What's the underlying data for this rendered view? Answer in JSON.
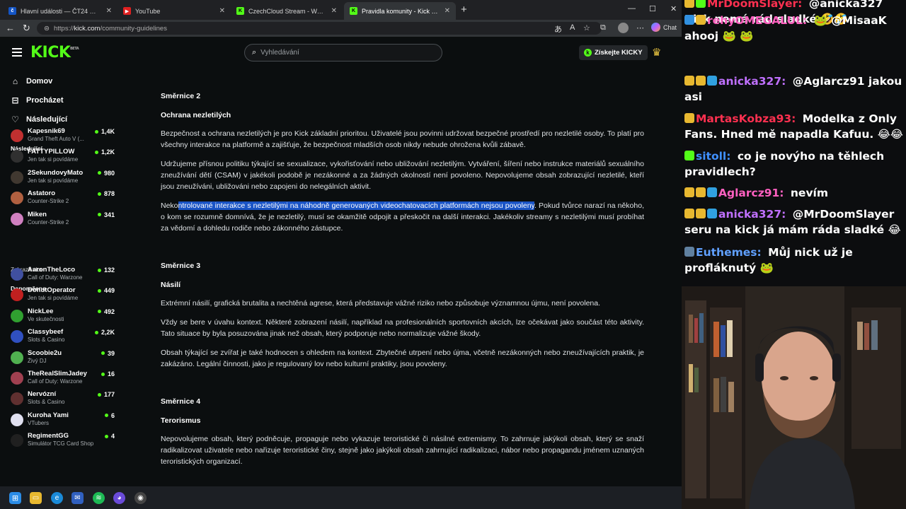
{
  "tabs": [
    {
      "label": "Hlavní události — ČT24 — Česká t",
      "favicon": "ct24",
      "color": "#1455c5"
    },
    {
      "label": "YouTube",
      "favicon": "youtube",
      "color": "#e02020"
    },
    {
      "label": "CzechCloud Stream - Watch Live o",
      "favicon": "kick",
      "color": "#53fc18"
    },
    {
      "label": "Pravidla komunity - Kick Streaming",
      "favicon": "kick",
      "color": "#53fc18"
    }
  ],
  "url": {
    "prefix": "https://",
    "host": "kick.com",
    "path": "/community-guidelines"
  },
  "chat_button": "Chat",
  "kick": {
    "logo": "KICK",
    "logo_beta": "BETA",
    "search_placeholder": "Vyhledávání",
    "kicky_button": "Získejte KICKY",
    "nav": [
      {
        "label": "Domov",
        "icon": "home-icon"
      },
      {
        "label": "Procházet",
        "icon": "browse-icon"
      },
      {
        "label": "Následující",
        "icon": "heart-icon"
      }
    ],
    "following_title": "Následující",
    "following": [
      {
        "name": "Kapesnik69",
        "category": "Grand Theft Auto V (...",
        "viewers": "1,4K",
        "color": "#c03030"
      },
      {
        "name": "FATTYPILLOW",
        "category": "Jen tak si povídáme",
        "viewers": "1,2K",
        "color": "#303030"
      },
      {
        "name": "2SekundovyMato",
        "category": "Jen tak si povídáme",
        "viewers": "980",
        "color": "#403830"
      },
      {
        "name": "Astatoro",
        "category": "Counter-Strike 2",
        "viewers": "878",
        "color": "#b06040"
      },
      {
        "name": "Miken",
        "category": "Counter-Strike 2",
        "viewers": "341",
        "color": "#d080c0"
      }
    ],
    "show_more": "Zobrazit více",
    "recommended_title": "Doporučeno",
    "recommended": [
      {
        "name": "AaronTheLoco",
        "category": "Call of Duty: Warzone",
        "viewers": "132",
        "color": "#4050a0"
      },
      {
        "name": "DonutOperator",
        "category": "Jen tak si povídáme",
        "viewers": "449",
        "color": "#c02020"
      },
      {
        "name": "NickLee",
        "category": "Ve skutečnosti",
        "viewers": "492",
        "color": "#30a030"
      },
      {
        "name": "Classybeef",
        "category": "Slots & Casino",
        "viewers": "2,2K",
        "color": "#3050c0"
      },
      {
        "name": "Scoobie2u",
        "category": "Živý DJ",
        "viewers": "39",
        "color": "#50b050"
      },
      {
        "name": "TheRealSlimJadey",
        "category": "Call of Duty: Warzone",
        "viewers": "16",
        "color": "#a04050"
      },
      {
        "name": "Nervózní",
        "category": "Slots & Casino",
        "viewers": "177",
        "color": "#603030"
      },
      {
        "name": "Kuroha Yami",
        "category": "VTubers",
        "viewers": "6",
        "color": "#e0e0f0"
      },
      {
        "name": "RegimentGG",
        "category": "Simulátor TCG Card Shop",
        "viewers": "4",
        "color": "#202020"
      }
    ],
    "guidelines": {
      "s2_title": "Směrnice 2",
      "s2_sub": "Ochrana nezletilých",
      "s2_p1": "Bezpečnost a ochrana nezletilých je pro Kick základní prioritou. Uživatelé jsou povinni udržovat bezpečné prostředí pro nezletilé osoby. To platí pro všechny interakce na platformě a zajišťuje, že bezpečnost mladších osob nikdy nebude ohrožena kvůli zábavě.",
      "s2_p2": "Udržujeme přísnou politiku týkající se sexualizace, vykořisťování nebo ubližování nezletilým. Vytváření, šíření nebo instrukce materiálů sexuálního zneužívání dětí (CSAM) v jakékoli podobě je nezákonné a za žádných okolností není povoleno. Nepovolujeme obsah zobrazující nezletilé, kteří jsou zneužíváni, ubližováni nebo zapojeni do nelegálních aktivit.",
      "s2_p3_pre": "Neko",
      "s2_p3_hl": "ntrolované interakce s nezletilými na náhodně generovaných videochatovacích platformách nejsou povoleny",
      "s2_p3_post": ". Pokud tvůrce narazí na někoho, o kom se rozumně domnívá, že je nezletilý, musí se okamžitě odpojit a přeskočit na další interakci. Jakékoliv streamy s nezletilými musí probíhat za vědomí a dohledu rodiče nebo zákonného zástupce.",
      "s3_title": "Směrnice 3",
      "s3_sub": "Násilí",
      "s3_p1": "Extrémní násilí, grafická brutalita a nechtěná agrese, která představuje vážné riziko nebo způsobuje významnou újmu, není povolena.",
      "s3_p2": "Vždy se bere v úvahu kontext. Některé zobrazení násilí, například na profesionálních sportovních akcích, lze očekávat jako součást této aktivity. Tato situace by byla posuzována jinak než obsah, který podporuje nebo normalizuje vážné škody.",
      "s3_p3": "Obsah týkající se zvířat je také hodnocen s ohledem na kontext. Zbytečné utrpení nebo újma, včetně nezákonných nebo zneužívajících praktik, je zakázáno. Legální činnosti, jako je regulovaný lov nebo kulturní praktiky, jsou povoleny.",
      "s4_title": "Směrnice 4",
      "s4_sub": "Terorismus",
      "s4_p1": "Nepovolujeme obsah, který podněcuje, propaguje nebo vykazuje teroristické či násilné extremismy. To zahrnuje jakýkoli obsah, který se snaží radikalizovat uživatele nebo nařizuje teroristické činy, stejně jako jakýkoli obsah zahrnující radikalizaci, nábor nebo propagandu jménem uznaných teroristických organizací."
    }
  },
  "chat": [
    {
      "user": "MrDoomSlayer:",
      "color": "#ff3050",
      "text": " @anicka327 Kick nemá rád sladké 🤣🤣"
    },
    {
      "user": "rehyOMEGALUL:",
      "color": "#ff60c0",
      "text": " 🐸 @MisaaK ahooj 🐸 🐸"
    },
    {
      "user": "anicka327:",
      "color": "#c070ff",
      "text": " @Aglarcz91 jakou asi"
    },
    {
      "user": "MartasKobza93:",
      "color": "#ff3050",
      "text": " Modelka z Only Fans. Hned mě napadla Kafuu. 😂😂"
    },
    {
      "user": "sitoll:",
      "color": "#4090ff",
      "text": " co je novýho na těhlech pravidlech?"
    },
    {
      "user": "Aglarcz91:",
      "color": "#ff60c0",
      "text": " nevím"
    },
    {
      "user": "anicka327:",
      "color": "#c070ff",
      "text": " @MrDoomSlayer seru na kick já mám ráda sladké 😂"
    },
    {
      "user": "Euthemes:",
      "color": "#60a0ff",
      "text": " Můj nick už je profláknutý 🐸"
    }
  ]
}
